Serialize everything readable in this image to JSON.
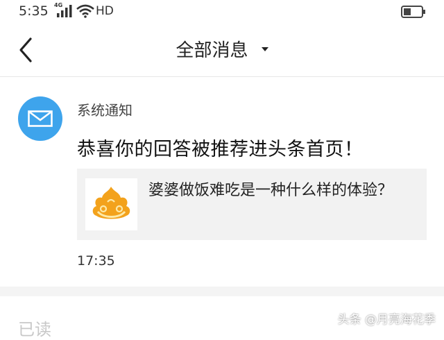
{
  "status_bar": {
    "time": "5:35",
    "network": "4G",
    "hd": "HD",
    "icons": [
      "signal-icon",
      "wifi-icon",
      "battery-icon"
    ]
  },
  "header": {
    "title": "全部消息",
    "back_icon": "chevron-left-icon",
    "dropdown_icon": "caret-down-icon"
  },
  "message": {
    "sender": "系统通知",
    "avatar_icon": "envelope-icon",
    "headline": "恭喜你的回答被推荐进头条首页！",
    "article": {
      "title": "婆婆做饭难吃是一种什么样的体验？",
      "thumbnail_icon": "golden-cloud-logo"
    },
    "time": "17:35"
  },
  "footer": {
    "read_label": "已读",
    "watermark": "头条 @月亮海花季"
  },
  "colors": {
    "avatar_bg": "#3ea4ec",
    "card_bg": "#f2f2f2",
    "separator": "#f4f4f4",
    "logo_gold": "#f3a21c"
  }
}
